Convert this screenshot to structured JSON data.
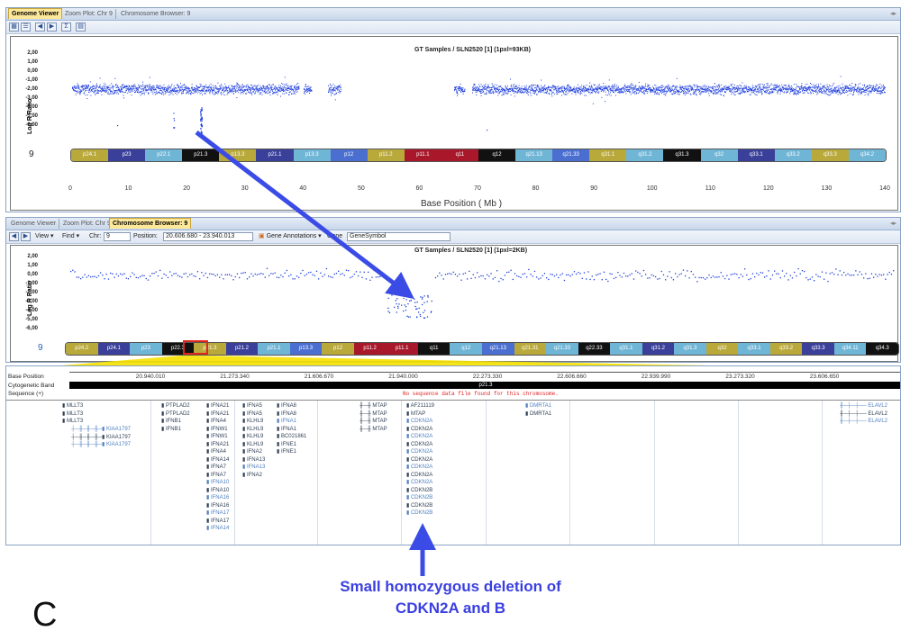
{
  "top_window": {
    "tabs": [
      "Genome Viewer",
      "Zoom Plot: Chr 9",
      "Chromosome Browser: 9"
    ],
    "active_tab_index": 0,
    "toolbar_icons": [
      "view-grid-icon",
      "view-list-icon",
      "back-icon",
      "forward-icon",
      "sort-icon",
      "chart-icon"
    ],
    "plot_title": "GT Samples / SLN2520 [1]  (1pxl=93KB)",
    "y_label": "Log R Ratio",
    "y_ticks": [
      "2,00",
      "1,00",
      "0,00",
      "-1,00",
      "-2,00",
      "-3,00",
      "-4,00",
      "-5,00",
      "-6,00"
    ],
    "chromosome": "9",
    "bands": [
      "p24.1",
      "p23",
      "p22.1",
      "p21.3",
      "p13.3",
      "p21.1",
      "p13.3",
      "p12",
      "p11.2",
      "p11.1",
      "q11",
      "q12",
      "q21.13",
      "q21.33",
      "q31.1",
      "q31.2",
      "q31.3",
      "q32",
      "q33.1",
      "q33.2",
      "q33.3",
      "q34.2"
    ],
    "x_ticks": [
      "0",
      "10",
      "20",
      "30",
      "40",
      "50",
      "60",
      "70",
      "80",
      "90",
      "100",
      "110",
      "120",
      "130",
      "140"
    ],
    "x_label": "Base Position ( Mb )"
  },
  "bottom_window": {
    "tabs": [
      "Genome Viewer",
      "Zoom Plot: Chr 9",
      "Chromosome Browser: 9"
    ],
    "active_tab_index": 2,
    "toolbar": {
      "view_label": "View",
      "find_label": "Find",
      "chr_label": "Chr:",
      "chr_value": "9",
      "position_label": "Position:",
      "position_value": "20.606.680 - 23.940.013",
      "gene_annotations_label": "Gene Annotations",
      "gene_label": "Gene",
      "gene_symbol_value": "GeneSymbol"
    },
    "plot_title": "GT Samples / SLN2520 [1]  (1pxl=2KB)",
    "y_label": "Log R Ratio",
    "y_ticks": [
      "2,00",
      "1,00",
      "0,00",
      "-1,00",
      "-2,00",
      "-3,00",
      "-4,00",
      "-5,00",
      "-6,00"
    ],
    "chromosome": "9",
    "bands": [
      "p24.2",
      "p24.1",
      "p23",
      "p22.3",
      "p21.3",
      "p21.2",
      "p21.1",
      "p13.3",
      "p12",
      "p11.2",
      "p11.1",
      "q11",
      "q12",
      "q21.13",
      "q21.31",
      "q21.33",
      "q22.33",
      "q31.1",
      "q31.2",
      "q31.3",
      "q32",
      "q33.1",
      "q33.2",
      "q33.3",
      "q34.11",
      "q34.3"
    ]
  },
  "tracks": {
    "base_position_label": "Base Position",
    "cytogenetic_band_label": "Cytogenetic Band",
    "sequence_label": "Sequence (+)",
    "positions": [
      "20.940.010",
      "21.273.340",
      "21.606.670",
      "21.940.000",
      "22.273.330",
      "22.606.660",
      "22.939.990",
      "23.273.320",
      "23.606.650",
      "23.93"
    ],
    "cyto_band_value": "p21.3",
    "no_sequence_msg": "No sequence data file found for this chromosome.",
    "gene_columns": [
      [
        "MLLT3",
        "MLLT3",
        "MLLT3"
      ],
      [
        "KIAA1797",
        "KIAA1797",
        "KIAA1797"
      ],
      [
        "PTPLAD2",
        "PTPLAD2",
        "IFNB1",
        "IFNB1"
      ],
      [
        "IFNA21",
        "IFNA21",
        "IFNA4",
        "IFNW1",
        "IFNW1",
        "IFNA21",
        "IFNA4",
        "IFNA14",
        "IFNA7",
        "IFNA7",
        "IFNA10",
        "IFNA10",
        "IFNA16",
        "IFNA16",
        "IFNA17",
        "IFNA17",
        "IFNA14"
      ],
      [
        "IFNA5",
        "IFNA5",
        "KLHL9",
        "KLHL9",
        "KLHL9",
        "KLHL9",
        "IFNA2",
        "IFNA13",
        "IFNA13",
        "IFNA2"
      ],
      [
        "IFNA8",
        "IFNA8",
        "IFNA1",
        "IFNA1",
        "BC021861",
        "IFNE1",
        "IFNE1"
      ],
      [
        "MTAP",
        "MTAP",
        "MTAP",
        "MTAP"
      ],
      [
        "AF211119",
        "MTAP",
        "CDKN2A",
        "CDKN2A",
        "CDKN2A",
        "CDKN2A",
        "CDKN2A",
        "CDKN2A",
        "CDKN2A",
        "CDKN2A",
        "CDKN2A",
        "CDKN2B",
        "CDKN2B",
        "CDKN2B",
        "CDKN2B"
      ],
      [
        "DMRTA1",
        "DMRTA1"
      ],
      [
        "ELAVL2",
        "ELAVL2",
        "ELAVL2"
      ]
    ]
  },
  "annotation": {
    "caption_line1": "Small homozygous deletion of",
    "caption_line2": "CDKN2A and B",
    "panel_letter": "C"
  },
  "colors": {
    "point_blue": "#1f3fdc",
    "arrow_blue": "#3b4ce6",
    "caption_blue": "#3a3fe0",
    "highlight_yellow": "#f5e100"
  }
}
